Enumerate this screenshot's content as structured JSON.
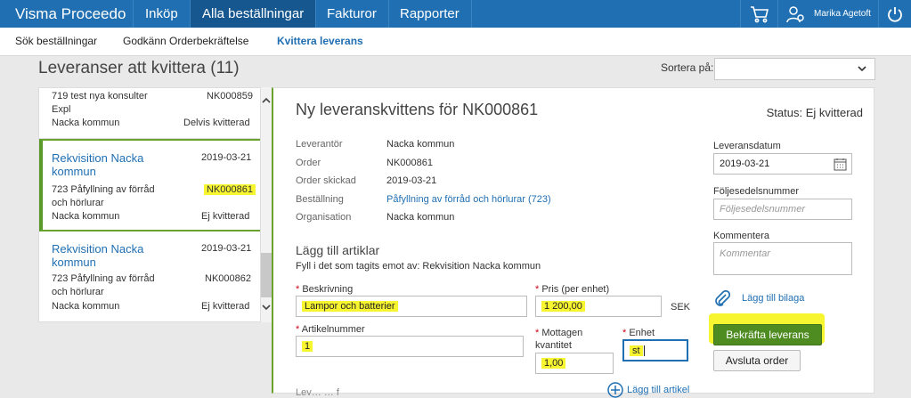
{
  "colors": {
    "accent": "#1f6fb2",
    "success": "#4e8c22",
    "highlight": "#f7f530",
    "required": "#d0021b"
  },
  "topnav": {
    "brand": "Visma Proceedo",
    "items": [
      "Inköp",
      "Alla beställningar",
      "Fakturor",
      "Rapporter"
    ],
    "active": "Alla beställningar",
    "user": "Marika Agetoft",
    "icons": [
      "cart-icon",
      "user-settings-icon",
      "power-icon"
    ]
  },
  "subnav": {
    "items": [
      "Sök beställningar",
      "Godkänn Orderbekräftelse",
      "Kvittera leverans"
    ],
    "active": "Kvittera leverans"
  },
  "page": {
    "title": "Leveranser att kvittera (11)",
    "sort_label": "Sortera på:",
    "sort_value": ""
  },
  "list": [
    {
      "line1": "719 test nya konsulter",
      "line2": "Expl",
      "number": "NK000859",
      "org": "Nacka kommun",
      "status": "Delvis kvitterad"
    },
    {
      "title": "Rekvisition Nacka kommun",
      "date": "2019-03-21",
      "line1": "723 Påfyllning av förråd",
      "line2": "och hörlurar",
      "number": "NK000861",
      "org": "Nacka kommun",
      "status": "Ej kvitterad"
    },
    {
      "title": "Rekvisition Nacka kommun",
      "date": "2019-03-21",
      "line1": "723 Påfyllning av förråd",
      "line2": "och hörlurar",
      "number": "NK000862",
      "org": "Nacka kommun",
      "status": "Ej kvitterad"
    }
  ],
  "detail": {
    "title": "Ny leveranskvittens för NK000861",
    "status": "Status: Ej kvitterad",
    "info": [
      {
        "label": "Leverantör",
        "value": "Nacka kommun"
      },
      {
        "label": "Order",
        "value": "NK000861"
      },
      {
        "label": "Order skickad",
        "value": "2019-03-21"
      },
      {
        "label": "Beställning",
        "value": "Påfyllning av förråd och hörlurar (723)"
      },
      {
        "label": "Organisation",
        "value": "Nacka kommun"
      }
    ],
    "add_title": "Lägg till artiklar",
    "add_sub": "Fyll i det som tagits emot av: Rekvisition Nacka kommun",
    "fields": {
      "beskrivning_label": "Beskrivning",
      "beskrivning_value": "Lampor och batterier",
      "pris_label": "Pris (per enhet)",
      "pris_value": "1 200,00",
      "currency": "SEK",
      "artikelnummer_label": "Artikelnummer",
      "artikelnummer_value": "1",
      "mottagen_label_1": "Mottagen",
      "mottagen_label_2": "kvantitet",
      "mottagen_value": "1,00",
      "enhet_label": "Enhet",
      "enhet_value": "st"
    },
    "add_item": "Lägg till artikel",
    "cut_text": "Lev…  …  f"
  },
  "side": {
    "leveransdatum_label": "Leveransdatum",
    "leveransdatum_value": "2019-03-21",
    "foljesedel_label": "Följesedelsnummer",
    "foljesedel_placeholder": "Följesedelsnummer",
    "kommentera_label": "Kommentera",
    "kommentera_placeholder": "Kommentar",
    "attach_label": "Lägg till bilaga",
    "confirm_button": "Bekräfta leverans",
    "close_button": "Avsluta order"
  }
}
